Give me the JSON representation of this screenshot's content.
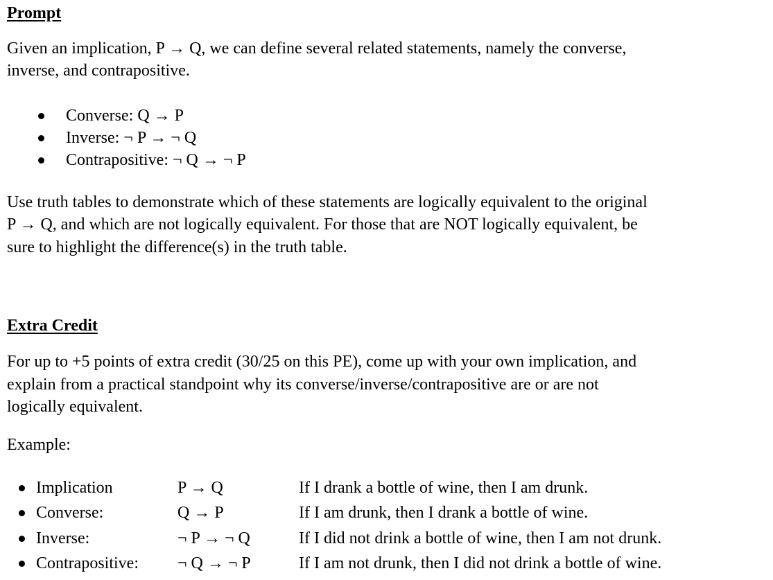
{
  "prompt": {
    "heading": "Prompt",
    "intro_lines": [
      "Given an implication, P → Q, we can define several related statements, namely the converse,",
      "inverse, and contrapositive."
    ],
    "bullets": [
      "Converse: Q → P",
      "Inverse: ¬ P →  ¬ Q",
      "Contrapositive:  ¬ Q → ¬ P"
    ],
    "instruction_lines": [
      "Use truth tables to demonstrate which of these statements are logically equivalent to the original",
      "P → Q, and which are not logically equivalent. For those that are NOT logically equivalent, be",
      "sure to highlight the difference(s) in the truth table."
    ]
  },
  "extra_credit": {
    "heading": "Extra Credit",
    "body_lines": [
      "For up to +5 points of extra credit (30/25 on this PE), come up with your own implication, and",
      "explain from a practical standpoint why its converse/inverse/contrapositive are or are not",
      "logically equivalent."
    ],
    "example_label": "Example:",
    "examples": [
      {
        "label": "Implication",
        "symbol": "P → Q",
        "text": "If I drank a bottle of wine, then I am drunk."
      },
      {
        "label": "Converse:",
        "symbol": "Q → P",
        "text": "If I am drunk, then I drank a bottle of wine."
      },
      {
        "label": "Inverse:",
        "symbol": "¬ P →  ¬ Q",
        "text": "If I did not drink a bottle of wine, then I am not drunk."
      },
      {
        "label": "Contrapositive:",
        "symbol": "¬ Q → ¬ P",
        "text": "If I am not drunk, then I did not drink a bottle of wine."
      }
    ]
  }
}
